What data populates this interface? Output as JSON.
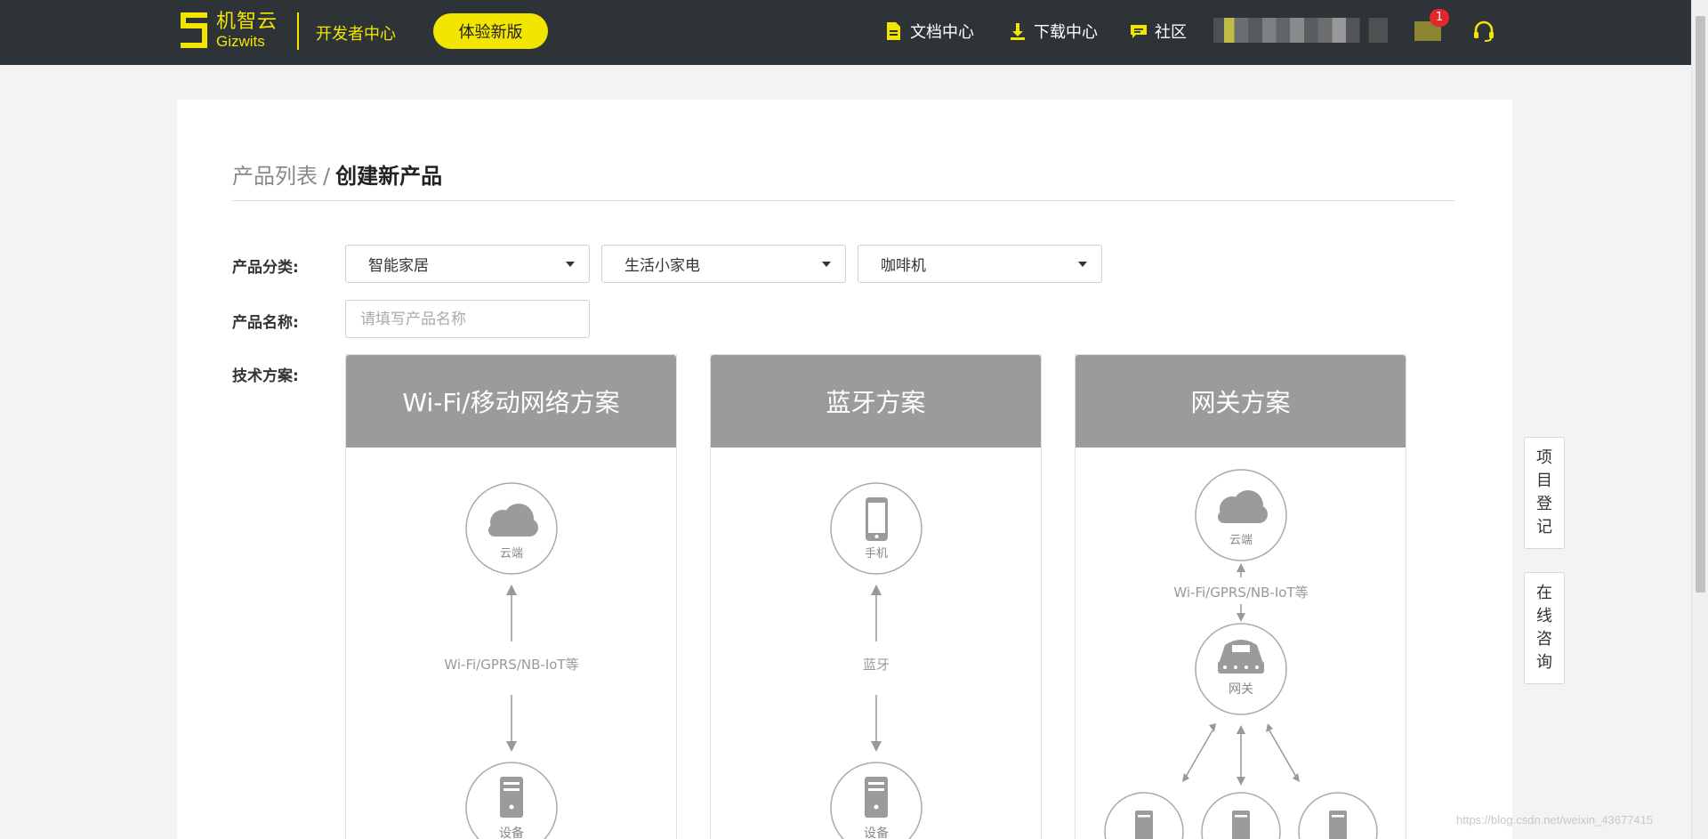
{
  "header": {
    "logo_cn": "机智云",
    "logo_en": "Gizwits",
    "dev_center": "开发者中心",
    "try_new": "体验新版",
    "nav": [
      {
        "label": "文档中心",
        "icon": "document-icon"
      },
      {
        "label": "下载中心",
        "icon": "download-icon"
      },
      {
        "label": "社区",
        "icon": "chat-icon"
      }
    ],
    "message_badge": "1"
  },
  "breadcrumb": {
    "parent": "产品列表",
    "separator": "/",
    "current": "创建新产品"
  },
  "form": {
    "category_label": "产品分类:",
    "category_values": [
      "智能家居",
      "生活小家电",
      "咖啡机"
    ],
    "name_label": "产品名称:",
    "name_placeholder": "请填写产品名称",
    "name_value": "",
    "tech_label": "技术方案:"
  },
  "plans": [
    {
      "title": "Wi-Fi/移动网络方案",
      "top_node": "云端",
      "link": "Wi-Fi/GPRS/NB-IoT等",
      "bottom_node": "设备"
    },
    {
      "title": "蓝牙方案",
      "top_node": "手机",
      "link": "蓝牙",
      "bottom_node": "设备"
    },
    {
      "title": "网关方案",
      "top_node": "云端",
      "link": "Wi-Fi/GPRS/NB-IoT等",
      "middle_node": "网关"
    }
  ],
  "side_tabs": {
    "project": "项目登记",
    "online": "在线咨询"
  },
  "watermark": "https://blog.csdn.net/weixin_43677415",
  "colors": {
    "brand_yellow": "#f2e600",
    "topbar_bg": "#2e3338",
    "plan_header": "#9b9b9b",
    "badge_red": "#e4262d"
  }
}
